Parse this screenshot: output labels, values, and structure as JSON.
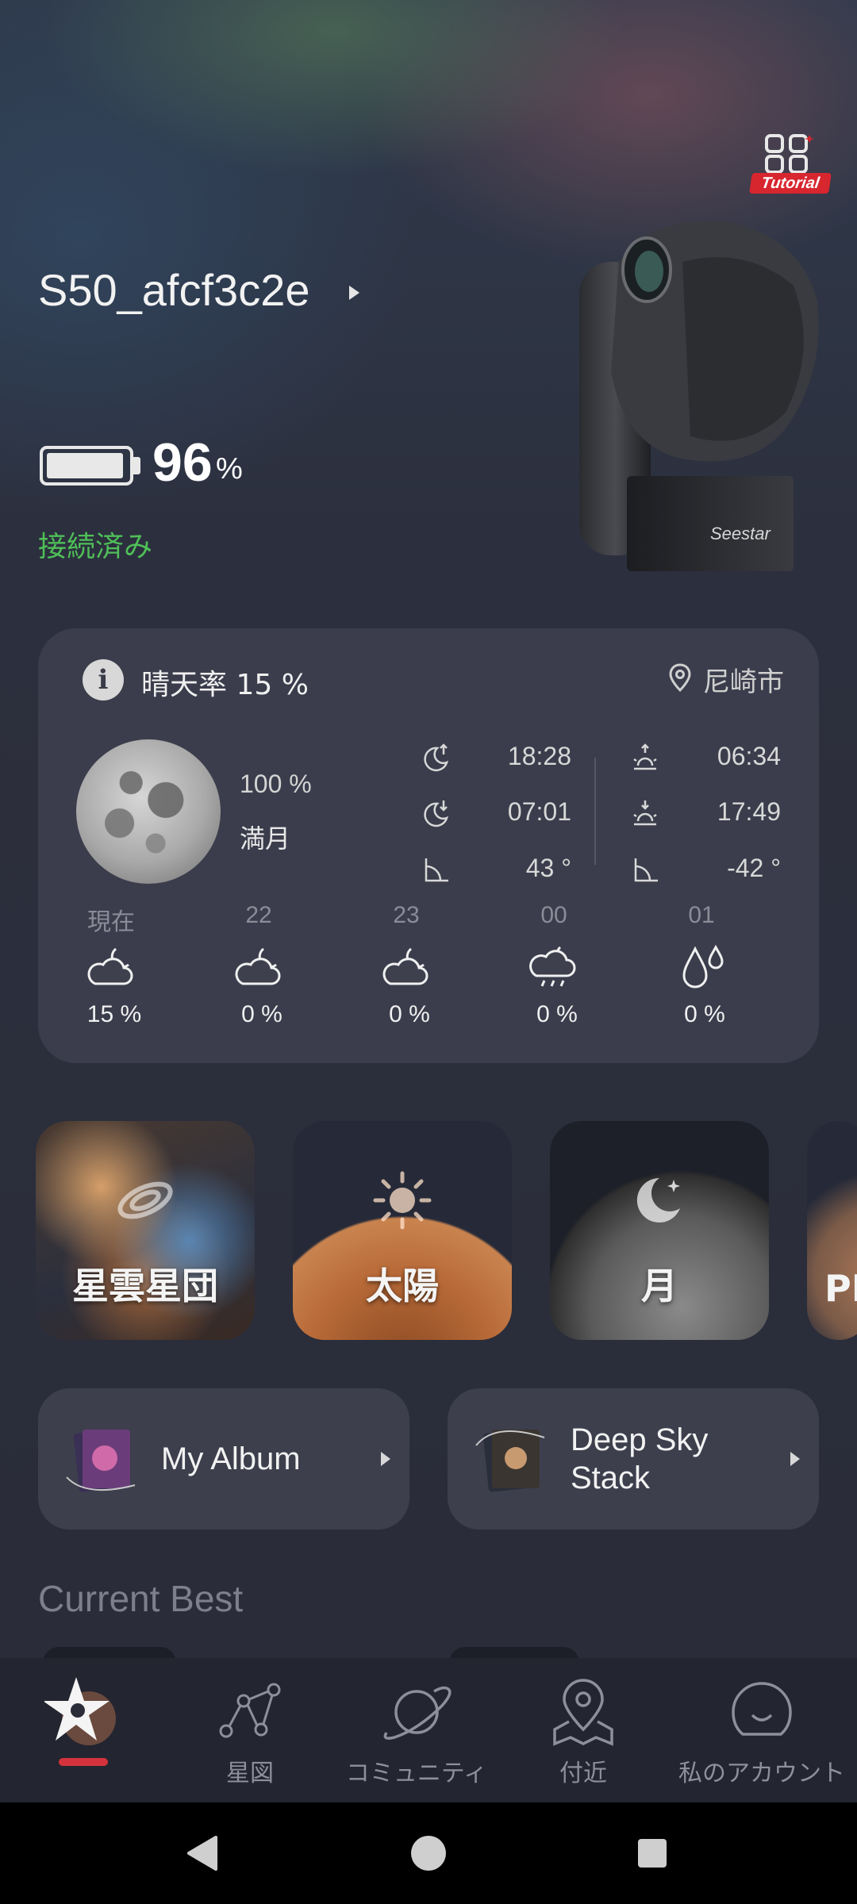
{
  "header": {
    "tutorial_label": "Tutorial",
    "device_name": "S50_afcf3c2e",
    "battery_level": 96,
    "battery_value": "96",
    "battery_unit": "%",
    "connection_status": "接続済み",
    "telescope_brand": "Seestar"
  },
  "weather": {
    "clear_rate": "晴天率 15 %",
    "location": "尼崎市",
    "moon_illumination": "100 %",
    "moon_phase": "満月",
    "moonrise": "18:28",
    "moonset": "07:01",
    "moon_altitude": "43 °",
    "sunrise": "06:34",
    "sunset": "17:49",
    "sun_altitude": "-42 °",
    "forecast": [
      {
        "hour": "現在",
        "icon": "cloudy-night-icon",
        "percent": "15 %"
      },
      {
        "hour": "22",
        "icon": "cloudy-night-icon",
        "percent": "0 %"
      },
      {
        "hour": "23",
        "icon": "cloudy-night-icon",
        "percent": "0 %"
      },
      {
        "hour": "00",
        "icon": "rain-cloud-icon",
        "percent": "0 %"
      },
      {
        "hour": "01",
        "icon": "humidity-drops-icon",
        "percent": "0 %"
      }
    ]
  },
  "categories": [
    {
      "label": "星雲星団",
      "icon": "galaxy-icon"
    },
    {
      "label": "太陽",
      "icon": "sun-icon"
    },
    {
      "label": "月",
      "icon": "moon-icon"
    },
    {
      "label": "PL"
    }
  ],
  "albums": {
    "my_album": "My Album",
    "deep_sky_line1": "Deep Sky",
    "deep_sky_line2": "Stack"
  },
  "section_title": "Current Best",
  "nav": [
    {
      "label": "",
      "icon": "seestar-home-icon",
      "active": true
    },
    {
      "label": "星図",
      "icon": "constellation-icon"
    },
    {
      "label": "コミュニティ",
      "icon": "planet-icon"
    },
    {
      "label": "付近",
      "icon": "map-pin-icon"
    },
    {
      "label": "私のアカウント",
      "icon": "profile-icon"
    }
  ],
  "colors": {
    "connected": "#4fbf58",
    "accent": "#d4333d",
    "card": "#3e404e"
  }
}
